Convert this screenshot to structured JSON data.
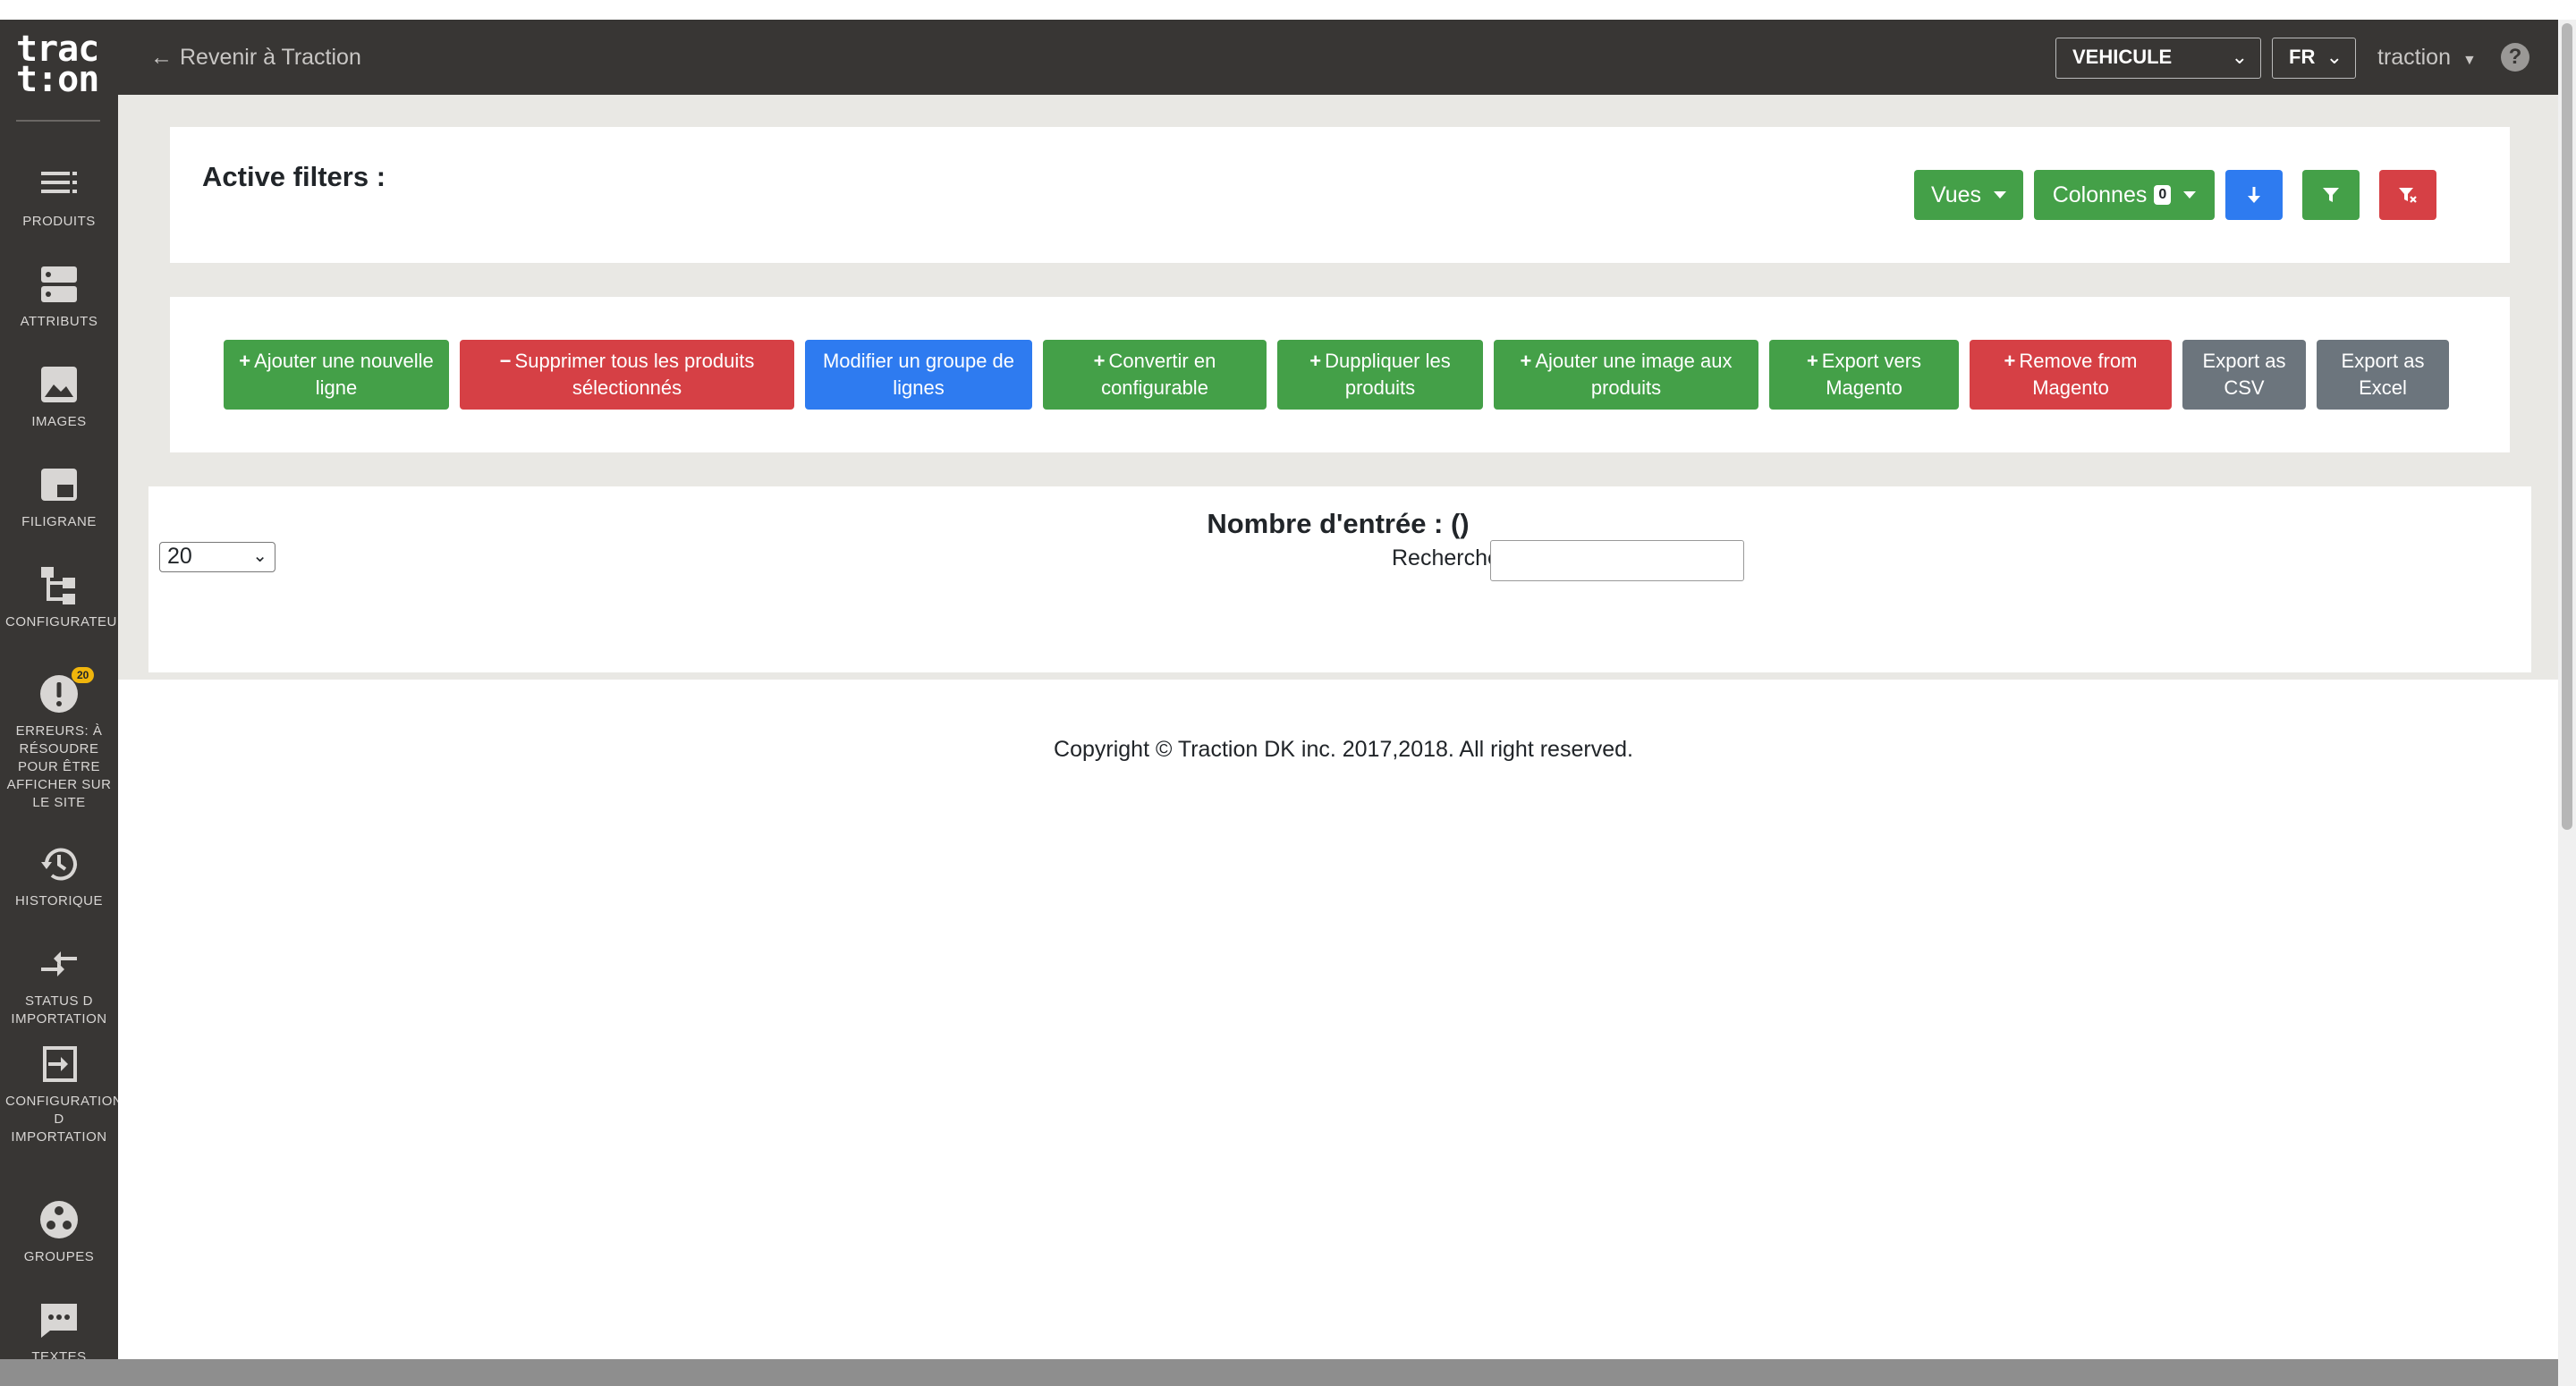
{
  "app": {
    "logo_line1": "trac",
    "logo_line2": "t:on",
    "back_label": "Revenir à Traction",
    "back_arrow": "←"
  },
  "sidebar": {
    "items": [
      {
        "label": "PRODUITS",
        "icon": "list-icon"
      },
      {
        "label": "ATTRIBUTS",
        "icon": "server-icon"
      },
      {
        "label": "IMAGES",
        "icon": "image-icon"
      },
      {
        "label": "FILIGRANE",
        "icon": "watermark-icon"
      },
      {
        "label": "CONFIGURATEUR",
        "icon": "hierarchy-icon"
      },
      {
        "label": "ERREURS: À RÉSOUDRE POUR ÊTRE AFFICHER SUR LE SITE",
        "icon": "error-icon",
        "badge": "20"
      },
      {
        "label": "HISTORIQUE",
        "icon": "history-icon"
      },
      {
        "label": "STATUS D IMPORTATION",
        "icon": "import-arrows-icon"
      },
      {
        "label": "CONFIGURATION D IMPORTATION",
        "icon": "login-icon"
      },
      {
        "label": "GROUPES",
        "icon": "groups-icon"
      },
      {
        "label": "TEXTES",
        "icon": "chat-icon"
      }
    ]
  },
  "header": {
    "vehicle_select": "VEHICULE",
    "lang_select": "FR",
    "user": "traction",
    "help": "?"
  },
  "filters": {
    "title": "Active filters :",
    "vues_label": "Vues",
    "colonnes_label": "Colonnes",
    "colonnes_count": "0"
  },
  "actions": [
    {
      "label": "Ajouter une nouvelle ligne",
      "color": "green",
      "plus": "+"
    },
    {
      "label": "Supprimer tous les produits sélectionnés",
      "color": "red",
      "plus": "−"
    },
    {
      "label": "Modifier un groupe de lignes",
      "color": "blue",
      "plus": ""
    },
    {
      "label": "Convertir en configurable",
      "color": "green",
      "plus": "+"
    },
    {
      "label": "Duppliquer les produits",
      "color": "green",
      "plus": "+"
    },
    {
      "label": "Ajouter une image aux produits",
      "color": "green",
      "plus": "+"
    },
    {
      "label": "Export vers Magento",
      "color": "green",
      "plus": "+"
    },
    {
      "label": "Remove from Magento",
      "color": "red",
      "plus": "+"
    },
    {
      "label": "Export as CSV",
      "color": "gray",
      "plus": ""
    },
    {
      "label": "Export as Excel",
      "color": "gray",
      "plus": ""
    }
  ],
  "table": {
    "title": "Nombre d'entrée : ()",
    "page_size": "20",
    "search_label": "Rechercher:",
    "search_value": ""
  },
  "footer": {
    "copyright": "Copyright © Traction DK inc. 2017,2018. All right reserved."
  },
  "colors": {
    "dark": "#383634",
    "green": "#44a048",
    "red": "#d64045",
    "blue": "#2e7bf0",
    "gray": "#6c757d"
  }
}
